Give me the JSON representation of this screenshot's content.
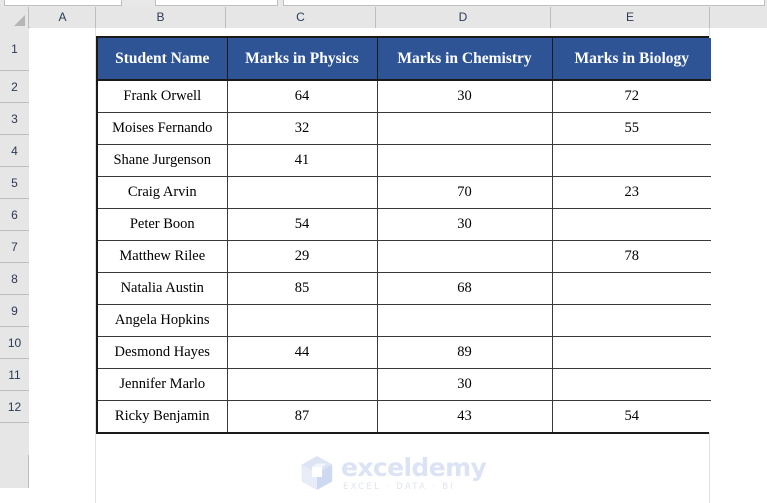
{
  "app": {
    "type": "spreadsheet",
    "accent_header_color": "#2E5496",
    "header_text_color": "#FFFFFF",
    "grid_line_color": "#E0E0E0",
    "table_border_color": "#1A1A1A"
  },
  "column_headers": [
    "A",
    "B",
    "C",
    "D",
    "E"
  ],
  "row_headers": [
    "1",
    "2",
    "3",
    "4",
    "5",
    "6",
    "7",
    "8",
    "9",
    "10",
    "11",
    "12"
  ],
  "table": {
    "headers": [
      "Student Name",
      "Marks in Physics",
      "Marks in Chemistry",
      "Marks in Biology"
    ],
    "rows": [
      {
        "name": "Frank Orwell",
        "physics": "64",
        "chemistry": "30",
        "biology": "72"
      },
      {
        "name": "Moises Fernando",
        "physics": "32",
        "chemistry": "",
        "biology": "55"
      },
      {
        "name": "Shane Jurgenson",
        "physics": "41",
        "chemistry": "",
        "biology": ""
      },
      {
        "name": "Craig Arvin",
        "physics": "",
        "chemistry": "70",
        "biology": "23"
      },
      {
        "name": "Peter Boon",
        "physics": "54",
        "chemistry": "30",
        "biology": ""
      },
      {
        "name": "Matthew Rilee",
        "physics": "29",
        "chemistry": "",
        "biology": "78"
      },
      {
        "name": "Natalia Austin",
        "physics": "85",
        "chemistry": "68",
        "biology": ""
      },
      {
        "name": "Angela Hopkins",
        "physics": "",
        "chemistry": "",
        "biology": ""
      },
      {
        "name": "Desmond Hayes",
        "physics": "44",
        "chemistry": "89",
        "biology": ""
      },
      {
        "name": "Jennifer Marlo",
        "physics": "",
        "chemistry": "30",
        "biology": ""
      },
      {
        "name": "Ricky Benjamin",
        "physics": "87",
        "chemistry": "43",
        "biology": "54"
      }
    ]
  },
  "watermark": {
    "brand": "exceldemy",
    "tagline": "EXCEL · DATA · BI",
    "logo_icon": "cube-logo-icon",
    "brand_color": "#DBE3F4"
  }
}
